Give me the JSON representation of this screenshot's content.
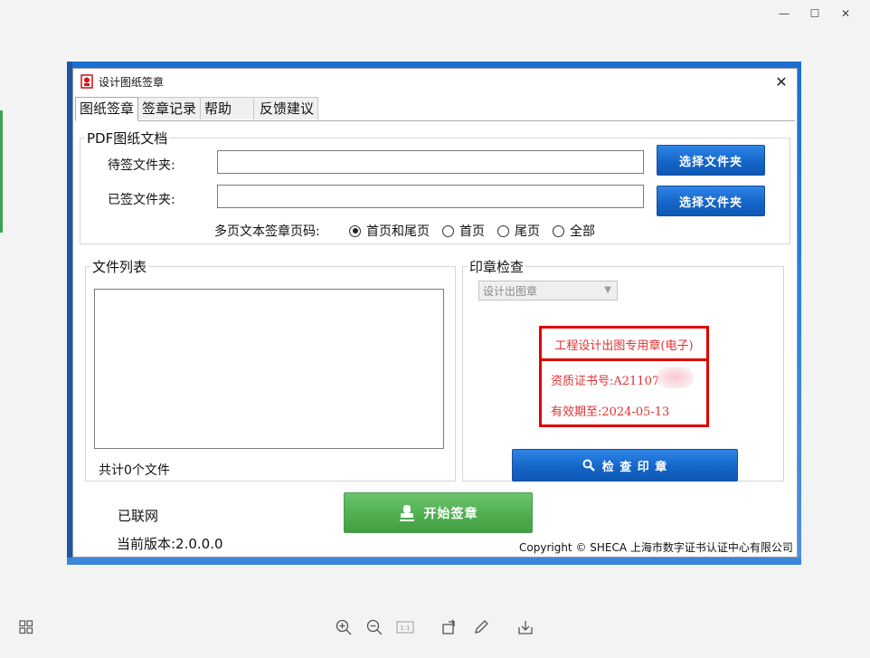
{
  "viewer": {
    "controls": [
      "—",
      "☐",
      "✕"
    ],
    "toolbar_icons": [
      "grid-view",
      "zoom-in",
      "zoom-out",
      "actual-size",
      "rotate",
      "edit",
      "save"
    ]
  },
  "window": {
    "title": "设计图纸签章",
    "close_glyph": "✕"
  },
  "tabs": [
    {
      "label": "图纸签章",
      "active": true
    },
    {
      "label": "签章记录",
      "active": false
    },
    {
      "label": "帮助",
      "active": false
    },
    {
      "label": "反馈建议",
      "active": false
    }
  ],
  "pdf_group": {
    "title": "PDF图纸文档",
    "pending_label": "待签文件夹:",
    "signed_label": "已签文件夹:",
    "pending_value": "",
    "signed_value": "",
    "choose_folder_button": "选择文件夹",
    "choose_folder_button2": "选择文件夹",
    "pages_label": "多页文本签章页码:",
    "page_options": [
      {
        "label": "首页和尾页",
        "selected": true
      },
      {
        "label": "首页",
        "selected": false
      },
      {
        "label": "尾页",
        "selected": false
      },
      {
        "label": "全部",
        "selected": false
      }
    ]
  },
  "file_list": {
    "title": "文件列表",
    "count_text": "共计0个文件"
  },
  "seal_check": {
    "title": "印章检查",
    "seal_type": "设计出图章",
    "seal_heading": "工程设计出图专用章(电子)",
    "cert_text": "资质证书号:A21107",
    "valid_text": "有效期至:2024-05-13",
    "check_button": "检 查 印 章"
  },
  "footer": {
    "network_status": "已联网",
    "version_text": "当前版本:2.0.0.0",
    "start_button": "开始签章",
    "copyright": "Copyright © SHECA 上海市数字证书认证中心有限公司"
  },
  "colors": {
    "seal_red": "#e00000",
    "button_blue": "#1466c8",
    "button_green": "#4eae4e"
  }
}
